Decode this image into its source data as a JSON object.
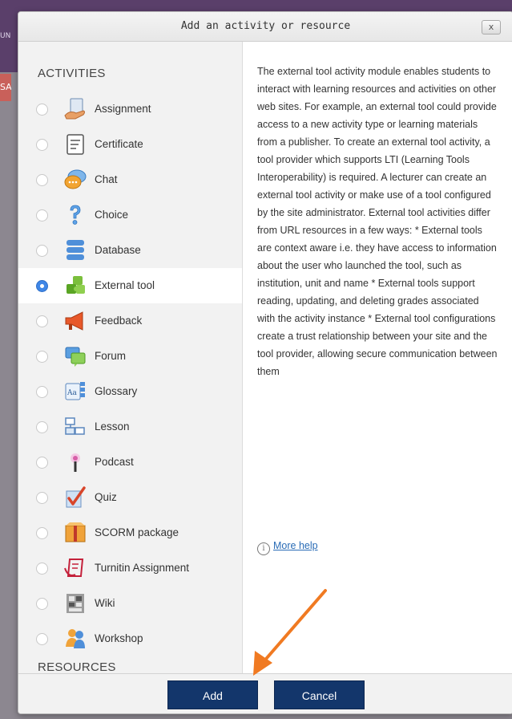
{
  "dialog": {
    "title": "Add an activity or resource",
    "close_label": "x"
  },
  "background": {
    "side_text_top": "UN",
    "side_text_badge": "SA"
  },
  "activities_heading": "ACTIVITIES",
  "resources_heading": "RESOURCES",
  "activities": [
    {
      "label": "Assignment",
      "icon": "assignment-icon",
      "selected": false
    },
    {
      "label": "Certificate",
      "icon": "certificate-icon",
      "selected": false
    },
    {
      "label": "Chat",
      "icon": "chat-icon",
      "selected": false
    },
    {
      "label": "Choice",
      "icon": "choice-icon",
      "selected": false
    },
    {
      "label": "Database",
      "icon": "database-icon",
      "selected": false
    },
    {
      "label": "External tool",
      "icon": "external-tool-icon",
      "selected": true
    },
    {
      "label": "Feedback",
      "icon": "feedback-icon",
      "selected": false
    },
    {
      "label": "Forum",
      "icon": "forum-icon",
      "selected": false
    },
    {
      "label": "Glossary",
      "icon": "glossary-icon",
      "selected": false
    },
    {
      "label": "Lesson",
      "icon": "lesson-icon",
      "selected": false
    },
    {
      "label": "Podcast",
      "icon": "podcast-icon",
      "selected": false
    },
    {
      "label": "Quiz",
      "icon": "quiz-icon",
      "selected": false
    },
    {
      "label": "SCORM package",
      "icon": "scorm-package-icon",
      "selected": false
    },
    {
      "label": "Turnitin Assignment",
      "icon": "turnitin-icon",
      "selected": false
    },
    {
      "label": "Wiki",
      "icon": "wiki-icon",
      "selected": false
    },
    {
      "label": "Workshop",
      "icon": "workshop-icon",
      "selected": false
    }
  ],
  "description": "The external tool activity module enables students to interact with learning resources and activities on other web sites. For example, an external tool could provide access to a new activity type or learning materials from a publisher. To create an external tool activity, a tool provider which supports LTI (Learning Tools Interoperability) is required. A lecturer can create an external tool activity or make use of a tool configured by the site administrator. External tool activities differ from URL resources in a few ways: * External tools are context aware i.e. they have access to information about the user who launched the tool, such as institution, unit and name * External tools support reading, updating, and deleting grades associated with the activity instance * External tool configurations create a trust relationship between your site and the tool provider, allowing secure communication between them",
  "more_help_label": "More help",
  "buttons": {
    "add": "Add",
    "cancel": "Cancel"
  },
  "colors": {
    "primary_button": "#13366b",
    "radio_selected": "#3f86e6",
    "link": "#2a6cb6",
    "annotation_arrow": "#f07a22"
  }
}
